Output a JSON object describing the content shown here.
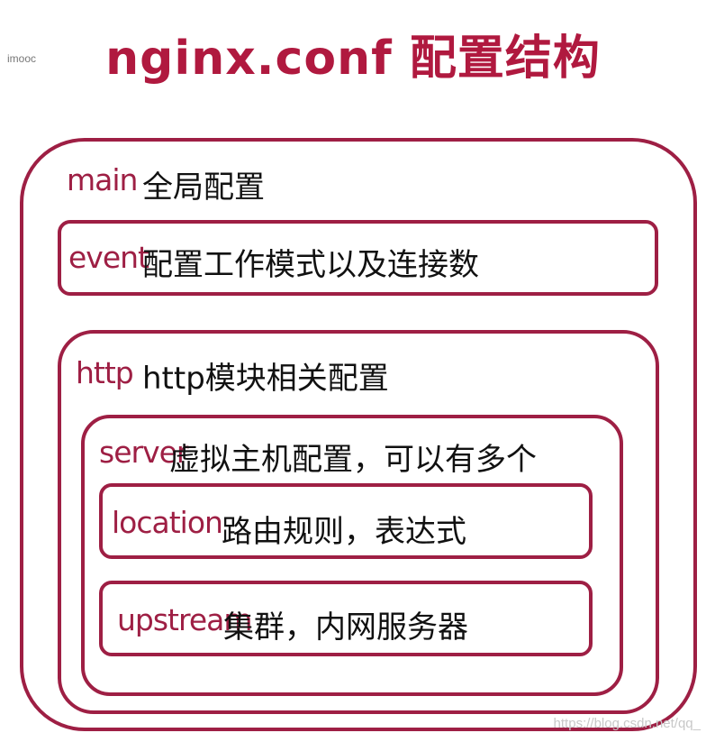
{
  "watermark_left": "imooc",
  "title": "nginx.conf 配置结构",
  "blocks": {
    "main": {
      "key": "main",
      "desc": "全局配置"
    },
    "event": {
      "key": "event",
      "desc": "配置工作模式以及连接数"
    },
    "http": {
      "key": "http",
      "desc": "http模块相关配置"
    },
    "server": {
      "key": "server",
      "desc": "虚拟主机配置，可以有多个"
    },
    "location": {
      "key": "location",
      "desc": "路由规则，表达式"
    },
    "upstream": {
      "key": "upstream",
      "desc": "集群，内网服务器"
    }
  },
  "watermark_bottom": "https://blog.csdn.net/qq_",
  "colors": {
    "accent": "#9e1f44",
    "title": "#b0193f",
    "text": "#111111"
  }
}
